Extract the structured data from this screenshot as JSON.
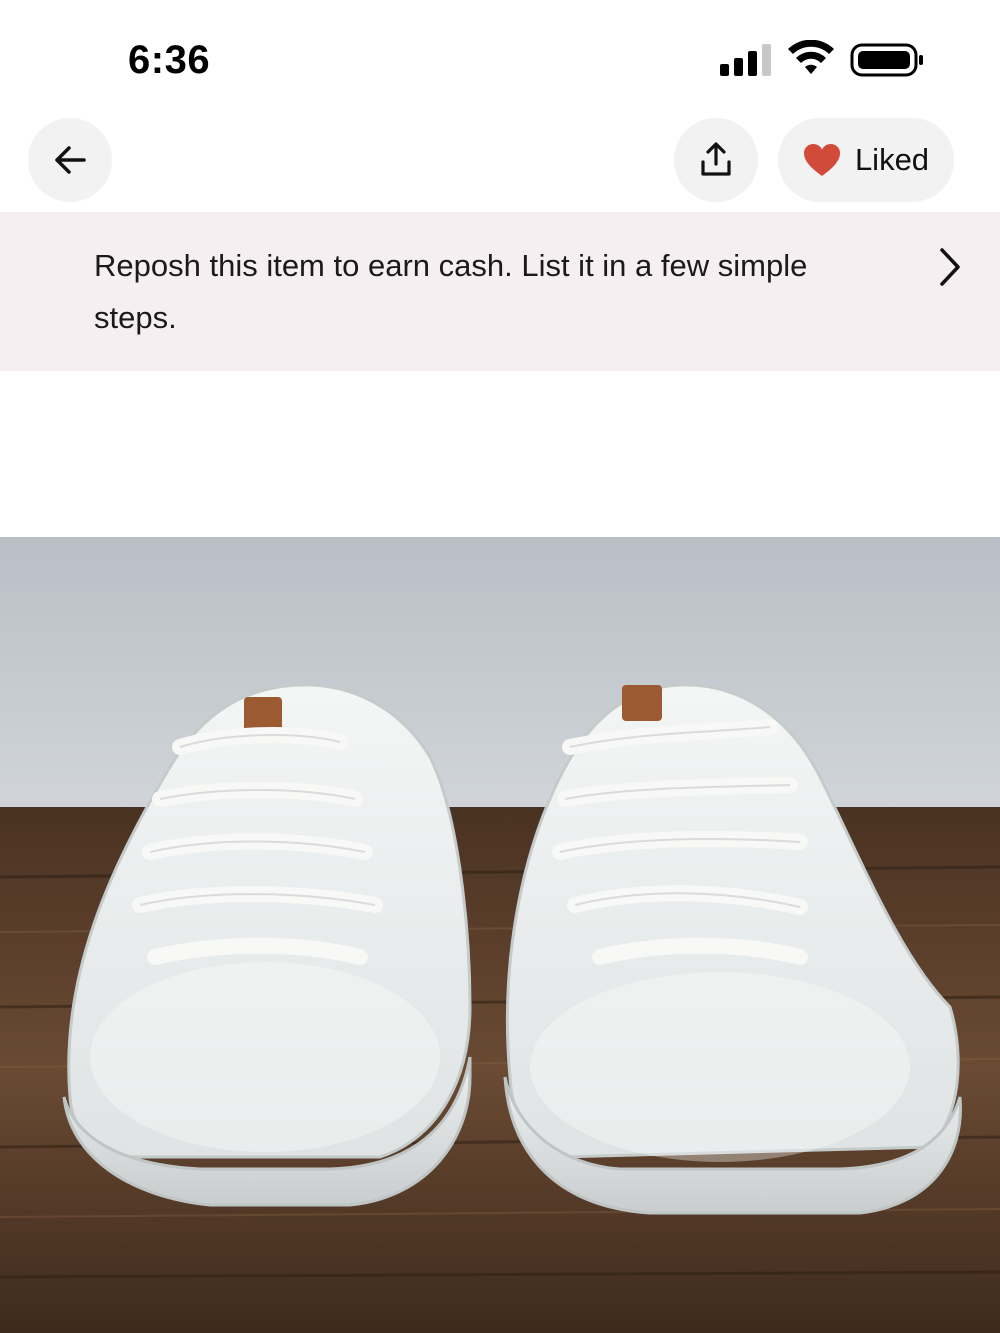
{
  "status_bar": {
    "time": "6:36",
    "icons": [
      "cellular-signal-icon",
      "wifi-icon",
      "battery-icon"
    ]
  },
  "nav": {
    "back_icon": "arrow-left-icon",
    "share_icon": "share-upload-icon",
    "liked_label": "Liked",
    "liked_icon": "heart-icon"
  },
  "banner": {
    "text": "Reposh this item to earn cash. List it in a few simple steps.",
    "chevron_icon": "chevron-right-icon"
  },
  "colors": {
    "banner_bg": "#f6eff1",
    "heart": "#d24a3a",
    "button_bg": "#f2f2f2"
  }
}
